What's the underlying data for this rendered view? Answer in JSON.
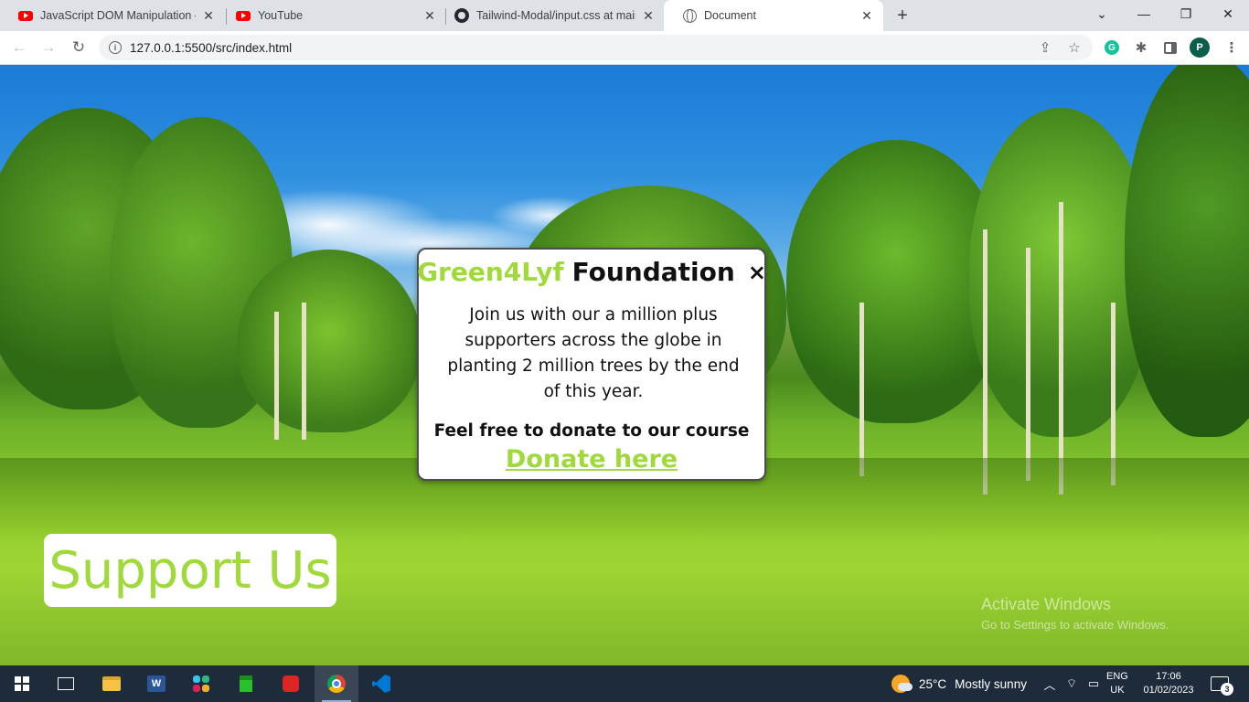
{
  "browser": {
    "tabs": [
      {
        "title": "JavaScript DOM Manipulation – F",
        "icon": "youtube-icon"
      },
      {
        "title": "YouTube",
        "icon": "youtube-icon"
      },
      {
        "title": "Tailwind-Modal/input.css at main",
        "icon": "github-icon"
      },
      {
        "title": "Document",
        "icon": "globe-icon",
        "active": true
      }
    ],
    "new_tab": "+",
    "address": "127.0.0.1:5500/src/index.html",
    "profile_initial": "P",
    "grammarly_initial": "G"
  },
  "page": {
    "modal": {
      "brand_green": "Green4Lyf",
      "brand_rest": "Foundation",
      "close": "×",
      "body": "Join us with our a million plus supporters across the globe in planting 2 million trees by the end of this year.",
      "cta": "Feel free to donate to our course",
      "link": "Donate here"
    },
    "support_button": "Support Us",
    "watermark": {
      "line1": "Activate Windows",
      "line2": "Go to Settings to activate Windows."
    }
  },
  "taskbar": {
    "weather_temp": "25°C",
    "weather_text": "Mostly sunny",
    "lang_top": "ENG",
    "lang_bottom": "UK",
    "time": "17:06",
    "date": "01/02/2023",
    "notification_count": "3"
  },
  "colors": {
    "brand_green": "#9fd93a",
    "taskbar_bg": "#1d2b3a"
  }
}
